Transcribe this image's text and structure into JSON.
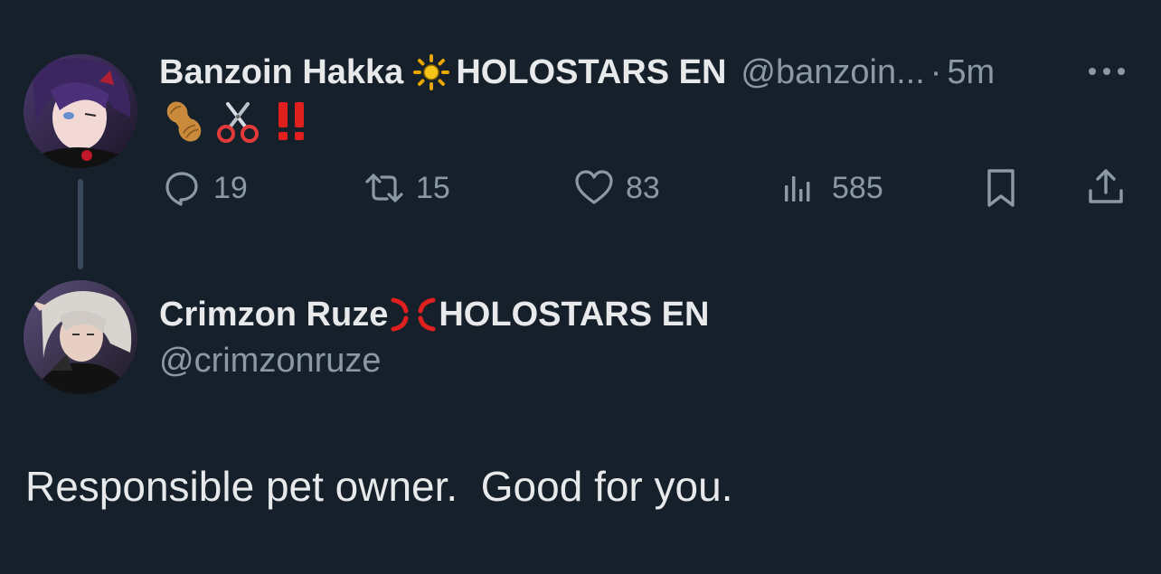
{
  "tweet1": {
    "display_name_part1": "Banzoin Hakka",
    "name_emoji": "sun-icon",
    "display_name_part2": "HOLOSTARS EN",
    "handle": "@banzoin...",
    "separator": "·",
    "time": "5m",
    "body_emojis": [
      "peanut-emoji",
      "scissors-emoji",
      "double-exclamation-emoji"
    ],
    "actions": {
      "replies": "19",
      "retweets": "15",
      "likes": "83",
      "views": "585"
    }
  },
  "tweet2": {
    "display_name_part1": "Crimzon Ruze",
    "name_emoji": "anger-symbol-icon",
    "display_name_part2": "HOLOSTARS EN",
    "handle": "@crimzonruze",
    "text": "Responsible pet owner.  Good for you."
  },
  "colors": {
    "background": "#15202b",
    "primary_text": "#e7e9ea",
    "secondary_text": "#8b98a5",
    "thread_line": "#3a4a5b",
    "exclamation_red": "#e0201e"
  }
}
